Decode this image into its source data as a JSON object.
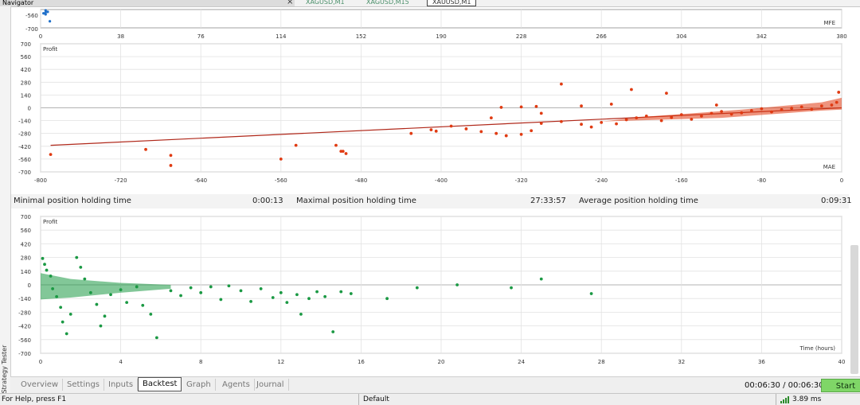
{
  "window": {
    "navigator_title": "Navigator",
    "close_symbol": "×",
    "symbol_tabs": [
      "XAGUSD,M1",
      "XAGUSD,M15",
      "XAUUSD,M1"
    ],
    "active_symbol_tab": 2,
    "sidebar_label": "Strategy Tester"
  },
  "colors": {
    "mfe_points": "#1f6fc9",
    "mae_points": "#e03b12",
    "mae_trend": "#b0281a",
    "time_points": "#1b9944",
    "grid": "#e2e2e2",
    "axis": "#555555"
  },
  "stats": {
    "min_label": "Minimal position holding time",
    "min_value": "0:00:13",
    "max_label": "Maximal position holding time",
    "max_value": "27:33:57",
    "avg_label": "Average position holding time",
    "avg_value": "0:09:31"
  },
  "bottom_tabs": [
    "Overview",
    "Settings",
    "Inputs",
    "Backtest",
    "Graph",
    "Agents",
    "Journal"
  ],
  "active_bottom_tab": 3,
  "timer": "00:06:30 / 00:06:30",
  "start_label": "Start",
  "status": {
    "help": "For Help, press F1",
    "profile": "Default",
    "ping": "3.89 ms",
    "signal_icon": "signal-bars-icon"
  },
  "chart_data": [
    {
      "type": "scatter",
      "xlabel": "MFE",
      "ylabel": "",
      "x_ticks": [
        0,
        38,
        76,
        114,
        152,
        190,
        228,
        266,
        304,
        342,
        380
      ],
      "y_tick_labels": [
        "-560",
        "-700"
      ],
      "xlim": [
        0,
        380
      ],
      "grid": true,
      "series": [
        {
          "values": [
            [
              1,
              -570
            ],
            [
              2,
              -560
            ],
            [
              2,
              -540
            ],
            [
              3,
              -555
            ],
            [
              2,
              -580
            ],
            [
              4,
              -650
            ]
          ]
        }
      ]
    },
    {
      "type": "scatter",
      "ylabel": "Profit",
      "xlabel": "MAE",
      "x_ticks": [
        -800,
        -720,
        -640,
        -560,
        -480,
        -400,
        -320,
        -240,
        -160,
        -80,
        0
      ],
      "y_ticks": [
        700,
        560,
        420,
        280,
        140,
        0,
        -140,
        -280,
        -420,
        -560,
        -700
      ],
      "xlim": [
        -800,
        0
      ],
      "ylim": [
        -700,
        700
      ],
      "grid": true,
      "trendline": {
        "from": [
          -790,
          -410
        ],
        "to": [
          0,
          0
        ]
      },
      "series": [
        {
          "values": [
            [
              -790,
              -510
            ],
            [
              -695,
              -455
            ],
            [
              -670,
              -520
            ],
            [
              -670,
              -630
            ],
            [
              -560,
              -560
            ],
            [
              -545,
              -410
            ],
            [
              -505,
              -410
            ],
            [
              -500,
              -475
            ],
            [
              -498,
              -475
            ],
            [
              -495,
              -500
            ],
            [
              -430,
              -280
            ],
            [
              -410,
              -240
            ],
            [
              -405,
              -255
            ],
            [
              -390,
              -200
            ],
            [
              -375,
              -230
            ],
            [
              -360,
              -260
            ],
            [
              -345,
              -280
            ],
            [
              -335,
              -305
            ],
            [
              -320,
              -290
            ],
            [
              -310,
              -250
            ],
            [
              -300,
              -170
            ],
            [
              -280,
              -150
            ],
            [
              -260,
              -180
            ],
            [
              -250,
              -210
            ],
            [
              -240,
              -160
            ],
            [
              -225,
              -175
            ],
            [
              -215,
              -130
            ],
            [
              -205,
              -110
            ],
            [
              -195,
              -90
            ],
            [
              -180,
              -140
            ],
            [
              -170,
              -105
            ],
            [
              -160,
              -75
            ],
            [
              -150,
              -125
            ],
            [
              -140,
              -90
            ],
            [
              -130,
              -60
            ],
            [
              -120,
              -40
            ],
            [
              -110,
              -70
            ],
            [
              -100,
              -55
            ],
            [
              -90,
              -30
            ],
            [
              -80,
              -10
            ],
            [
              -70,
              -45
            ],
            [
              -60,
              -20
            ],
            [
              -50,
              -5
            ],
            [
              -40,
              10
            ],
            [
              -30,
              -15
            ],
            [
              -20,
              20
            ],
            [
              -10,
              30
            ],
            [
              -5,
              60
            ],
            [
              -3,
              170
            ],
            [
              -280,
              260
            ],
            [
              -210,
              200
            ],
            [
              -175,
              160
            ],
            [
              -125,
              30
            ],
            [
              -340,
              5
            ],
            [
              -320,
              10
            ],
            [
              -305,
              15
            ],
            [
              -230,
              40
            ],
            [
              -260,
              20
            ],
            [
              -300,
              -60
            ],
            [
              -350,
              -110
            ]
          ]
        }
      ]
    },
    {
      "type": "scatter",
      "ylabel": "Profit",
      "xlabel": "Time (hours)",
      "x_ticks": [
        0,
        4,
        8,
        12,
        16,
        20,
        24,
        28,
        32,
        36,
        40
      ],
      "y_ticks": [
        700,
        560,
        420,
        280,
        140,
        0,
        -140,
        -280,
        -420,
        -560,
        -700
      ],
      "xlim": [
        0,
        40
      ],
      "ylim": [
        -700,
        700
      ],
      "grid": true,
      "series": [
        {
          "values": [
            [
              0.1,
              270
            ],
            [
              0.2,
              210
            ],
            [
              0.3,
              150
            ],
            [
              0.5,
              90
            ],
            [
              0.6,
              -40
            ],
            [
              0.8,
              -120
            ],
            [
              1.0,
              -230
            ],
            [
              1.1,
              -380
            ],
            [
              1.3,
              -500
            ],
            [
              1.5,
              -300
            ],
            [
              1.8,
              280
            ],
            [
              2.0,
              180
            ],
            [
              2.2,
              60
            ],
            [
              2.5,
              -80
            ],
            [
              2.8,
              -200
            ],
            [
              3.0,
              -420
            ],
            [
              3.2,
              -320
            ],
            [
              3.5,
              -100
            ],
            [
              4.0,
              -50
            ],
            [
              4.3,
              -180
            ],
            [
              4.8,
              -20
            ],
            [
              5.1,
              -210
            ],
            [
              5.5,
              -300
            ],
            [
              5.8,
              -540
            ],
            [
              6.5,
              -60
            ],
            [
              7.0,
              -110
            ],
            [
              7.5,
              -30
            ],
            [
              8.0,
              -80
            ],
            [
              8.5,
              -20
            ],
            [
              9.0,
              -150
            ],
            [
              9.4,
              -10
            ],
            [
              10.0,
              -60
            ],
            [
              10.5,
              -170
            ],
            [
              11.0,
              -40
            ],
            [
              11.6,
              -130
            ],
            [
              12.0,
              -80
            ],
            [
              12.3,
              -180
            ],
            [
              12.8,
              -100
            ],
            [
              13.0,
              -300
            ],
            [
              13.4,
              -140
            ],
            [
              13.8,
              -70
            ],
            [
              14.2,
              -120
            ],
            [
              14.6,
              -480
            ],
            [
              15.0,
              -70
            ],
            [
              15.5,
              -90
            ],
            [
              17.3,
              -140
            ],
            [
              18.8,
              -30
            ],
            [
              20.8,
              0
            ],
            [
              23.5,
              -30
            ],
            [
              25.0,
              60
            ],
            [
              27.5,
              -90
            ]
          ]
        }
      ]
    }
  ]
}
